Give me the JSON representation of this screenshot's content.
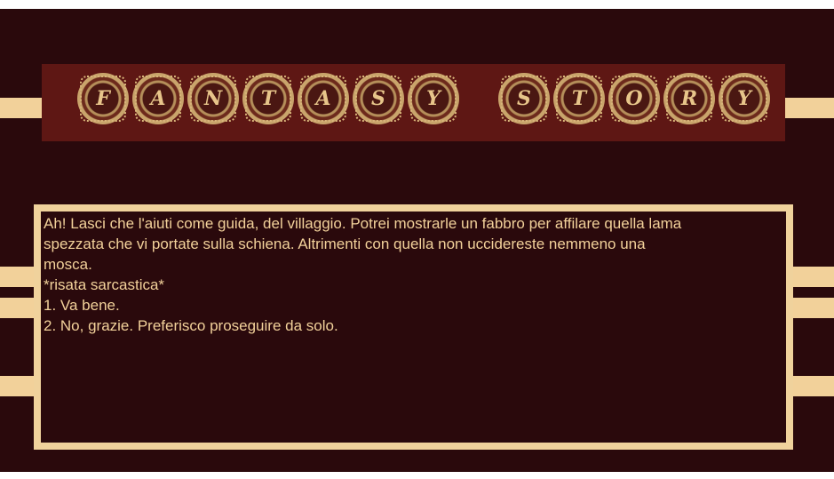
{
  "title": {
    "letters": [
      "F",
      "A",
      "N",
      "T",
      "A",
      "S",
      "Y",
      "S",
      "T",
      "O",
      "R",
      "Y"
    ]
  },
  "dialog": {
    "text": "Ah! Lasci che l'aiuti come guida, del villaggio. Potrei mostrarle un fabbro per affilare quella lama\nspezzata che vi portate sulla schiena. Altrimenti con quella non uccidereste nemmeno una\nmosca.\n*risata sarcastica*\n",
    "choices": [
      "1. Va bene.",
      "2. No, grazie. Preferisco proseguire da solo."
    ]
  },
  "colors": {
    "background": "#2a090c",
    "banner": "#5e1714",
    "accent": "#f2d19a"
  }
}
